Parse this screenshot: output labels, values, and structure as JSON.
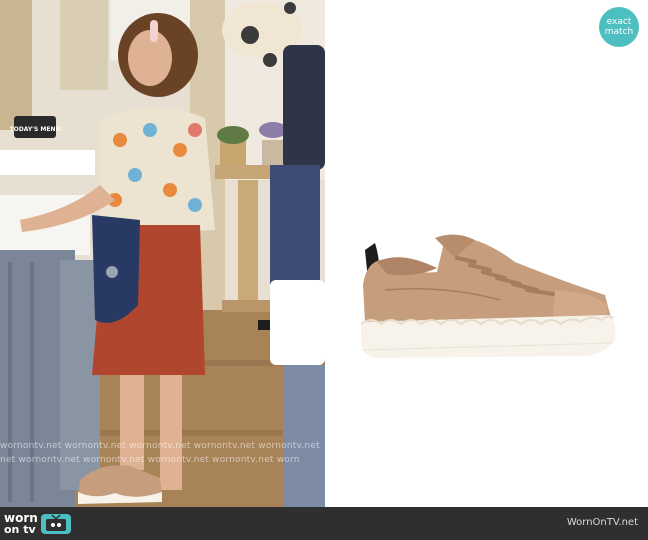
{
  "photo": {
    "sign_text": "TODAY'S MENU",
    "watermark_rows": [
      "wornontv.net   wornontv.net   wornontv.net   wornontv.net   wornontv.net",
      "net   wornontv.net   wornontv.net   wornontv.net   wornontv.net   worn"
    ]
  },
  "badge": {
    "line1": "exact",
    "line2": "match"
  },
  "footer": {
    "logo_line1": "worn",
    "logo_line2": "on tv",
    "site_url": "WornOnTV.net"
  },
  "colors": {
    "accent": "#4dbfc1",
    "footer_bg": "#2f2f2f",
    "sneaker_leather": "#c79e7d",
    "sneaker_sole": "#f7f3ea"
  }
}
